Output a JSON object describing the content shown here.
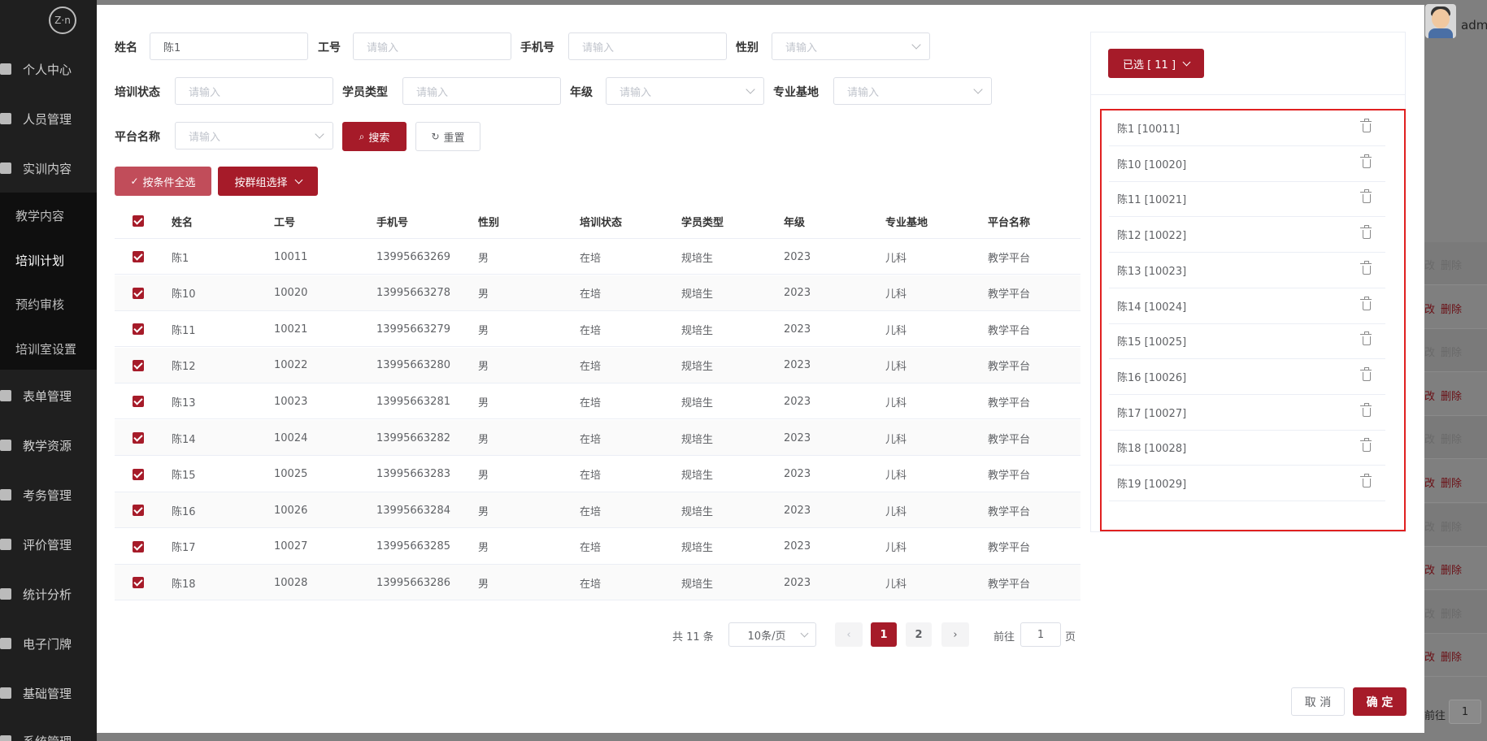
{
  "app": {
    "logo_text": "Z·n",
    "user_name": "adm",
    "menu": [
      {
        "label": "个人中心"
      },
      {
        "label": "人员管理"
      },
      {
        "label": "实训内容"
      },
      {
        "label": "表单管理"
      },
      {
        "label": "教学资源"
      },
      {
        "label": "考务管理"
      },
      {
        "label": "评价管理"
      },
      {
        "label": "统计分析"
      },
      {
        "label": "电子门牌"
      },
      {
        "label": "基础管理"
      },
      {
        "label": "系统管理"
      }
    ],
    "submenu": [
      {
        "label": "教学内容"
      },
      {
        "label": "培训计划"
      },
      {
        "label": "预约审核"
      },
      {
        "label": "培训室设置"
      }
    ],
    "bg_actions": {
      "edit": "改",
      "delete": "删除"
    },
    "bg_goto_label": "前往",
    "bg_goto_value": "1"
  },
  "filters": {
    "name_label": "姓名",
    "name_value": "陈1",
    "id_label": "工号",
    "id_placeholder": "请输入",
    "phone_label": "手机号",
    "phone_placeholder": "请输入",
    "gender_label": "性别",
    "gender_placeholder": "请输入",
    "status_label": "培训状态",
    "status_placeholder": "请输入",
    "type_label": "学员类型",
    "type_placeholder": "请输入",
    "grade_label": "年级",
    "grade_placeholder": "请输入",
    "base_label": "专业基地",
    "base_placeholder": "请输入",
    "platform_label": "平台名称",
    "platform_placeholder": "请输入",
    "search_button": "搜索",
    "reset_button": "重置"
  },
  "actions": {
    "select_all_button": "按条件全选",
    "group_select_button": "按群组选择"
  },
  "table": {
    "columns": [
      "姓名",
      "工号",
      "手机号",
      "性别",
      "培训状态",
      "学员类型",
      "年级",
      "专业基地",
      "平台名称"
    ],
    "rows": [
      {
        "name": "陈1",
        "id": "10011",
        "phone": "13995663269",
        "gender": "男",
        "status": "在培",
        "type": "规培生",
        "grade": "2023",
        "base": "儿科",
        "platform": "教学平台"
      },
      {
        "name": "陈10",
        "id": "10020",
        "phone": "13995663278",
        "gender": "男",
        "status": "在培",
        "type": "规培生",
        "grade": "2023",
        "base": "儿科",
        "platform": "教学平台"
      },
      {
        "name": "陈11",
        "id": "10021",
        "phone": "13995663279",
        "gender": "男",
        "status": "在培",
        "type": "规培生",
        "grade": "2023",
        "base": "儿科",
        "platform": "教学平台"
      },
      {
        "name": "陈12",
        "id": "10022",
        "phone": "13995663280",
        "gender": "男",
        "status": "在培",
        "type": "规培生",
        "grade": "2023",
        "base": "儿科",
        "platform": "教学平台"
      },
      {
        "name": "陈13",
        "id": "10023",
        "phone": "13995663281",
        "gender": "男",
        "status": "在培",
        "type": "规培生",
        "grade": "2023",
        "base": "儿科",
        "platform": "教学平台"
      },
      {
        "name": "陈14",
        "id": "10024",
        "phone": "13995663282",
        "gender": "男",
        "status": "在培",
        "type": "规培生",
        "grade": "2023",
        "base": "儿科",
        "platform": "教学平台"
      },
      {
        "name": "陈15",
        "id": "10025",
        "phone": "13995663283",
        "gender": "男",
        "status": "在培",
        "type": "规培生",
        "grade": "2023",
        "base": "儿科",
        "platform": "教学平台"
      },
      {
        "name": "陈16",
        "id": "10026",
        "phone": "13995663284",
        "gender": "男",
        "status": "在培",
        "type": "规培生",
        "grade": "2023",
        "base": "儿科",
        "platform": "教学平台"
      },
      {
        "name": "陈17",
        "id": "10027",
        "phone": "13995663285",
        "gender": "男",
        "status": "在培",
        "type": "规培生",
        "grade": "2023",
        "base": "儿科",
        "platform": "教学平台"
      },
      {
        "name": "陈18",
        "id": "10028",
        "phone": "13995663286",
        "gender": "男",
        "status": "在培",
        "type": "规培生",
        "grade": "2023",
        "base": "儿科",
        "platform": "教学平台"
      }
    ]
  },
  "pagination": {
    "total_text": "共 11 条",
    "page_size": "10条/页",
    "pages": [
      "1",
      "2"
    ],
    "current_page": "1",
    "goto_label": "前往",
    "goto_value": "1",
    "page_suffix": "页",
    "prev_icon": "‹",
    "next_icon": "›"
  },
  "selected": {
    "button_label": "已选 [ 11 ]",
    "items": [
      "陈1 [10011]",
      "陈10 [10020]",
      "陈11 [10021]",
      "陈12 [10022]",
      "陈13 [10023]",
      "陈14 [10024]",
      "陈15 [10025]",
      "陈16 [10026]",
      "陈17 [10027]",
      "陈18 [10028]",
      "陈19 [10029]"
    ]
  },
  "footer": {
    "cancel_button": "取 消",
    "confirm_button": "确 定"
  },
  "colors": {
    "primary": "#a61b29",
    "highlight_border": "#e02020"
  }
}
